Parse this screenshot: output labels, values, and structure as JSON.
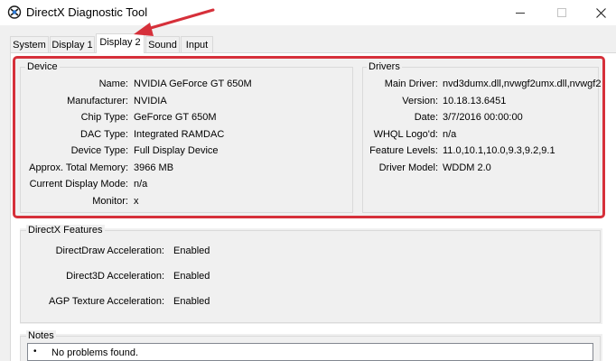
{
  "window": {
    "title": "DirectX Diagnostic Tool",
    "controls": {
      "minimize": "minimize",
      "maximize": "maximize",
      "close": "close"
    }
  },
  "tabs": [
    {
      "label": "System",
      "active": false
    },
    {
      "label": "Display 1",
      "active": false
    },
    {
      "label": "Display 2",
      "active": true
    },
    {
      "label": "Sound",
      "active": false
    },
    {
      "label": "Input",
      "active": false
    }
  ],
  "device": {
    "heading": "Device",
    "rows": [
      {
        "label": "Name:",
        "value": "NVIDIA GeForce GT 650M"
      },
      {
        "label": "Manufacturer:",
        "value": "NVIDIA"
      },
      {
        "label": "Chip Type:",
        "value": "GeForce GT 650M"
      },
      {
        "label": "DAC Type:",
        "value": "Integrated RAMDAC"
      },
      {
        "label": "Device Type:",
        "value": "Full Display Device"
      },
      {
        "label": "Approx. Total Memory:",
        "value": "3966 MB"
      },
      {
        "label": "Current Display Mode:",
        "value": "n/a"
      },
      {
        "label": "Monitor:",
        "value": "x"
      }
    ]
  },
  "drivers": {
    "heading": "Drivers",
    "rows": [
      {
        "label": "Main Driver:",
        "value": "nvd3dumx.dll,nvwgf2umx.dll,nvwgf2"
      },
      {
        "label": "Version:",
        "value": "10.18.13.6451"
      },
      {
        "label": "Date:",
        "value": "3/7/2016 00:00:00"
      },
      {
        "label": "WHQL Logo'd:",
        "value": "n/a"
      },
      {
        "label": "Feature Levels:",
        "value": "11.0,10.1,10.0,9.3,9.2,9.1"
      },
      {
        "label": "Driver Model:",
        "value": "WDDM 2.0"
      }
    ]
  },
  "directx_features": {
    "heading": "DirectX Features",
    "rows": [
      {
        "label": "DirectDraw Acceleration:",
        "value": "Enabled"
      },
      {
        "label": "Direct3D Acceleration:",
        "value": "Enabled"
      },
      {
        "label": "AGP Texture Acceleration:",
        "value": "Enabled"
      }
    ]
  },
  "notes": {
    "heading": "Notes",
    "items": [
      "No problems found."
    ]
  },
  "colors": {
    "highlight": "#d6303a",
    "arrow": "#d6303a"
  }
}
